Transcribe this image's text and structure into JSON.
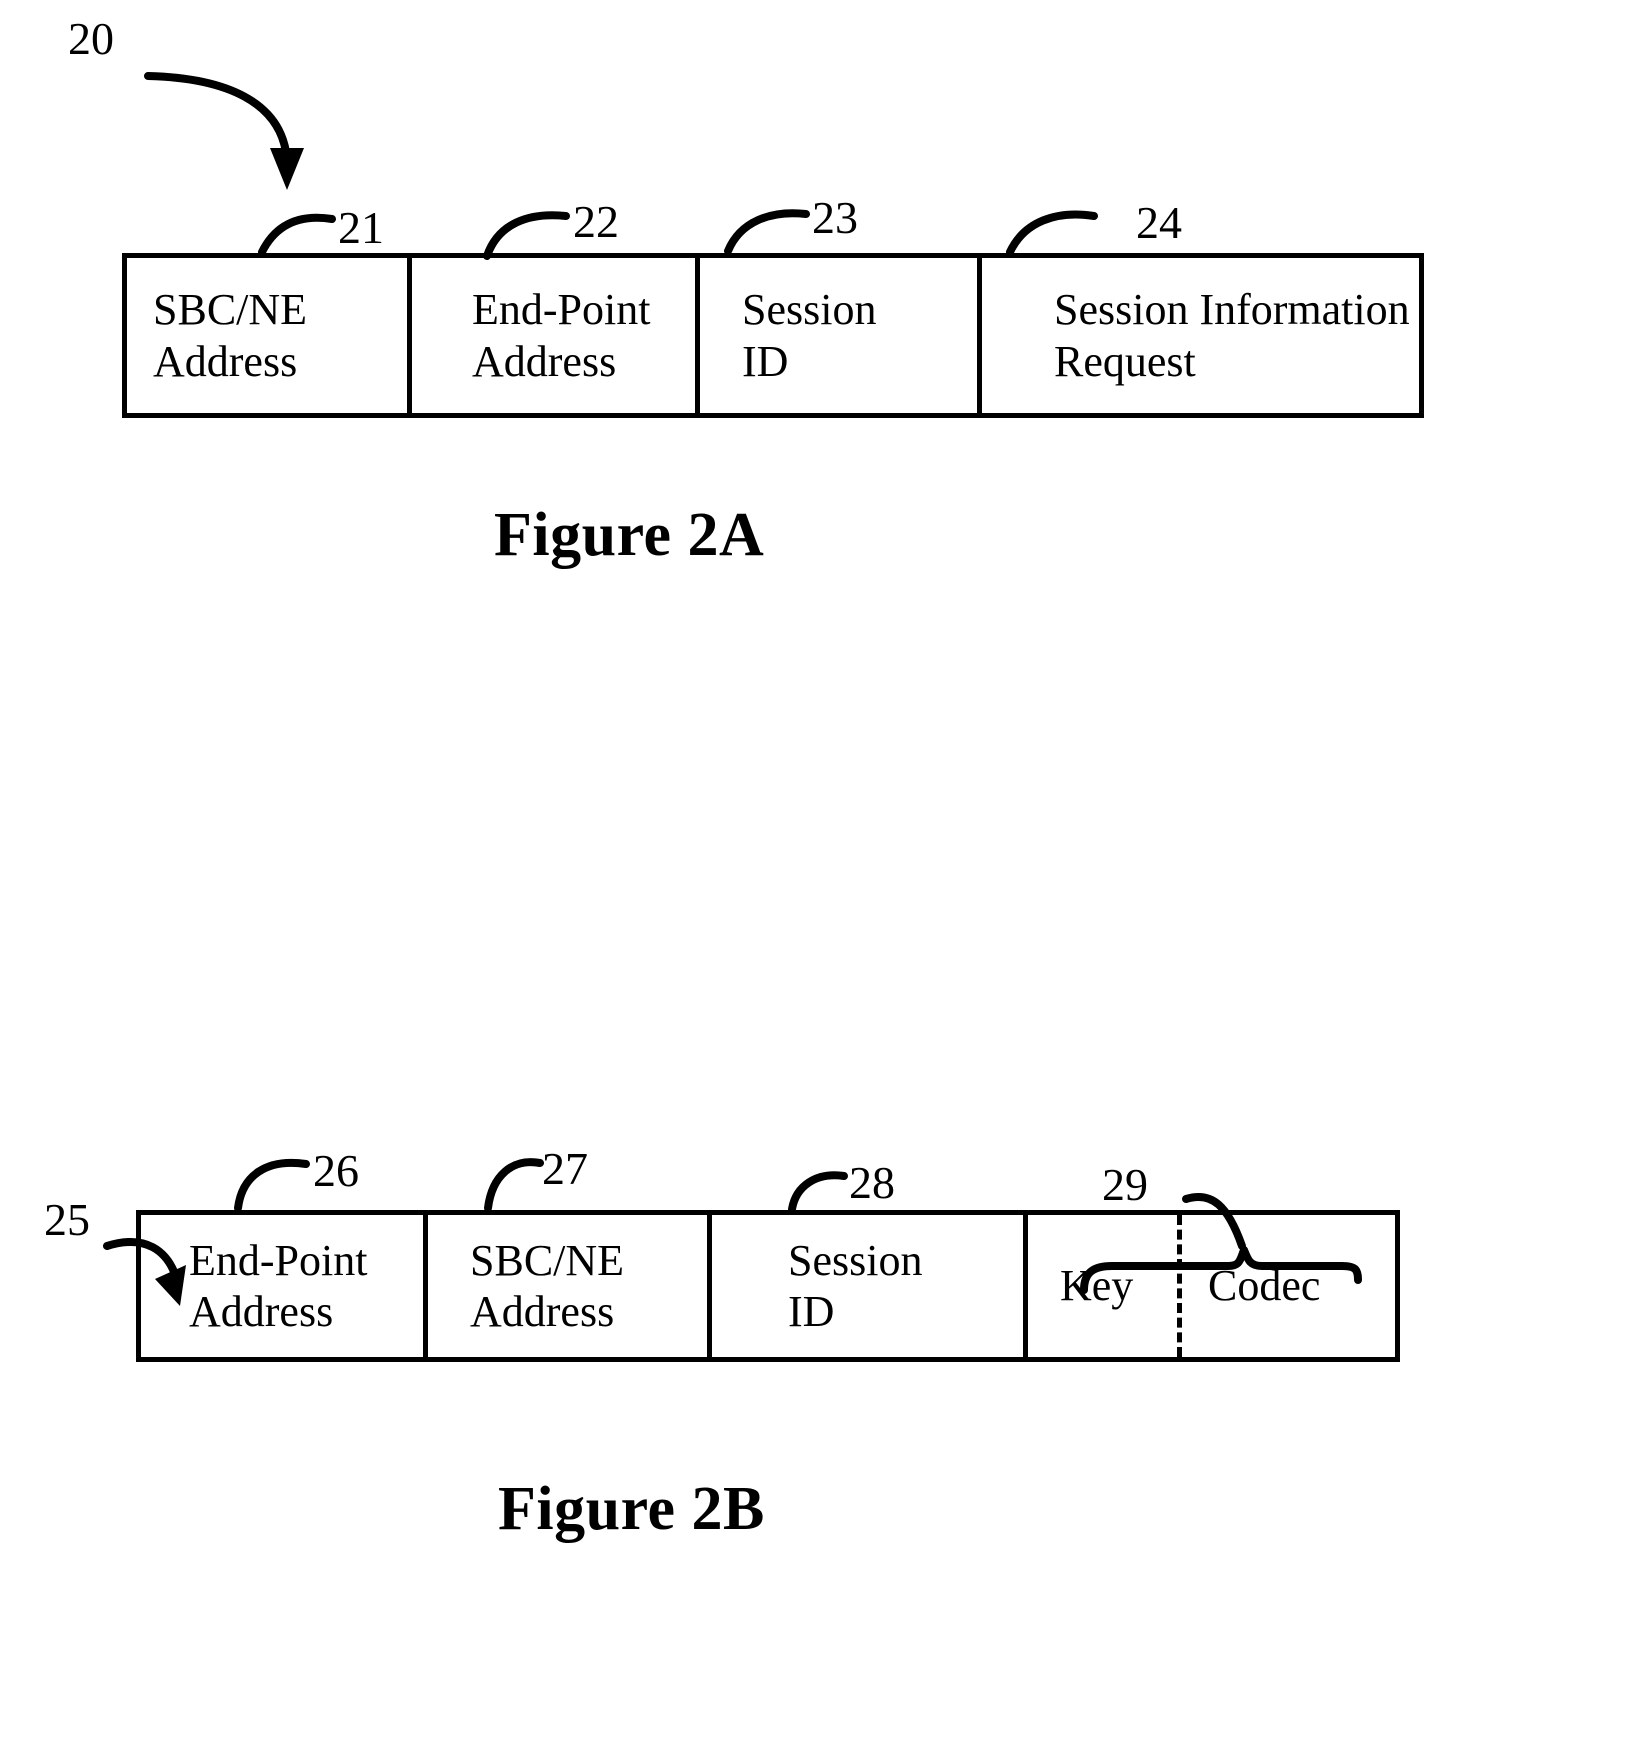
{
  "figure_2a": {
    "assembly_ref": "20",
    "caption": "Figure 2A",
    "fields": [
      {
        "ref": "21",
        "label": "SBC/NE\nAddress"
      },
      {
        "ref": "22",
        "label": "End-Point\nAddress"
      },
      {
        "ref": "23",
        "label": "Session\nID"
      },
      {
        "ref": "24",
        "label": "Session Information\nRequest"
      }
    ]
  },
  "figure_2b": {
    "assembly_ref": "25",
    "caption": "Figure 2B",
    "brace_ref": "29",
    "fields": [
      {
        "ref": "26",
        "label": "End-Point\nAddress"
      },
      {
        "ref": "27",
        "label": "SBC/NE\nAddress"
      },
      {
        "ref": "28",
        "label": "Session\nID"
      },
      {
        "ref": "",
        "label": "Key"
      },
      {
        "ref": "",
        "label": "Codec"
      }
    ]
  },
  "style": {
    "ink": "#000000",
    "paper": "#ffffff"
  }
}
